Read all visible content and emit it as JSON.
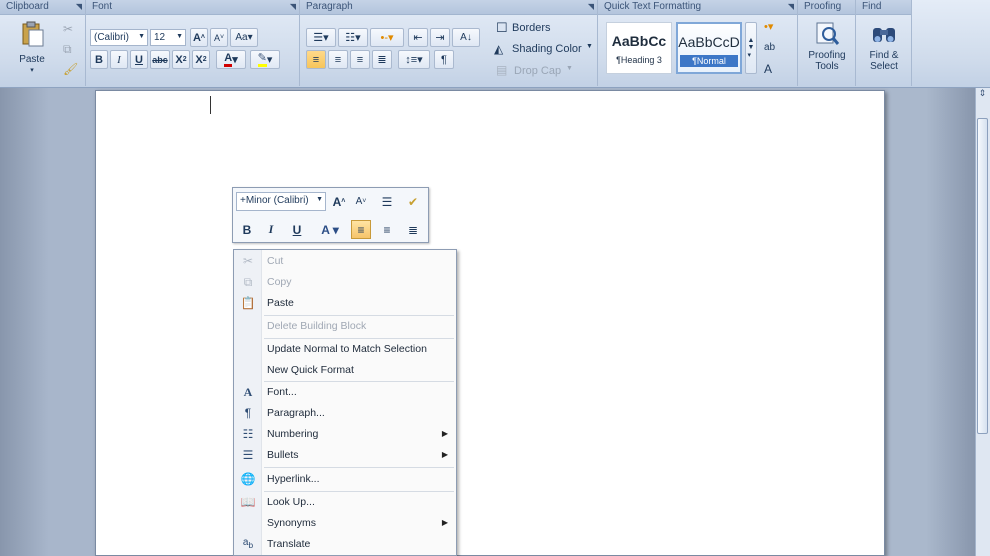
{
  "ribbon": {
    "groups": {
      "clipboard": "Clipboard",
      "font": "Font",
      "paragraph": "Paragraph",
      "quick_formatting": "Quick Text Formatting",
      "proofing": "Proofing",
      "find": "Find"
    },
    "paste_label": "Paste",
    "font_name": "(Calibri)",
    "font_size": "12",
    "borders_label": "Borders",
    "shading_label": "Shading Color",
    "dropcap_label": "Drop Cap",
    "styles": [
      {
        "sample": "AaBbCc",
        "label": "¶Heading 3"
      },
      {
        "sample": "AaBbCcD",
        "label": "¶Normal"
      }
    ],
    "proofing_label_1": "Proofing",
    "proofing_label_2": "Tools",
    "find_label_1": "Find &",
    "find_label_2": "Select"
  },
  "mini_toolbar": {
    "font_name": "+Minor (Calibri)"
  },
  "context_menu": {
    "items": [
      {
        "label": "Cut",
        "icon": "scissors-icon",
        "disabled": true
      },
      {
        "label": "Copy",
        "icon": "copy-icon",
        "disabled": true
      },
      {
        "label": "Paste",
        "icon": "paste-icon",
        "disabled": false
      },
      {
        "label": "Delete Building Block",
        "icon": "",
        "disabled": true
      },
      {
        "label": "Update Normal to Match Selection",
        "icon": "",
        "disabled": false
      },
      {
        "label": "New Quick Format",
        "icon": "",
        "disabled": false
      },
      {
        "label": "Font...",
        "icon": "font-icon",
        "disabled": false
      },
      {
        "label": "Paragraph...",
        "icon": "paragraph-icon",
        "disabled": false
      },
      {
        "label": "Numbering",
        "icon": "numbering-icon",
        "disabled": false,
        "submenu": true
      },
      {
        "label": "Bullets",
        "icon": "bullets-icon",
        "disabled": false,
        "submenu": true
      },
      {
        "label": "Hyperlink...",
        "icon": "hyperlink-icon",
        "disabled": false
      },
      {
        "label": "Look Up...",
        "icon": "lookup-icon",
        "disabled": false
      },
      {
        "label": "Synonyms",
        "icon": "",
        "disabled": false,
        "submenu": true
      },
      {
        "label": "Translate",
        "icon": "translate-icon",
        "disabled": false
      }
    ]
  }
}
